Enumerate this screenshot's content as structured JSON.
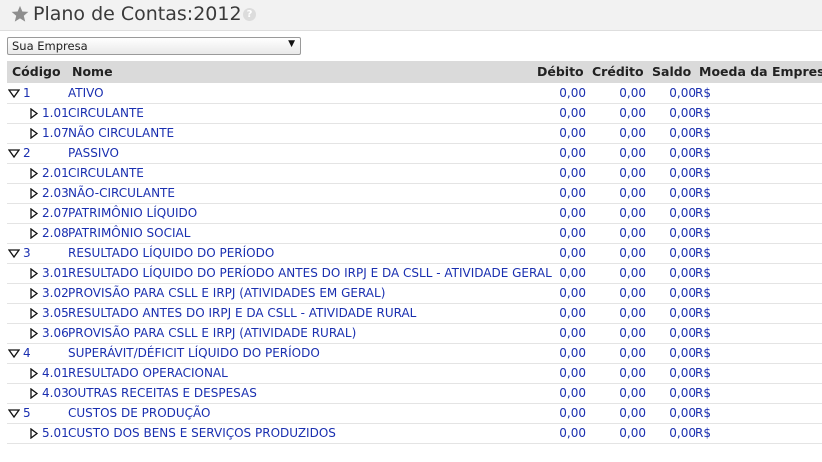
{
  "header": {
    "title": "Plano de Contas:2012",
    "help_icon": "?"
  },
  "company_select": {
    "value": "Sua Empresa",
    "arrow": "▼"
  },
  "columns": {
    "codigo": "Código",
    "nome": "Nome",
    "debito": "Débito",
    "credito": "Crédito",
    "saldo": "Saldo",
    "moeda": "Moeda da Empresa"
  },
  "colors": {
    "link": "#1a2fb0",
    "header_bg": "#dadada"
  },
  "rows": [
    {
      "level": 0,
      "expanded": true,
      "code": "1",
      "name": "ATIVO",
      "debito": "0,00",
      "credito": "0,00",
      "saldo": "0,00",
      "moeda": "R$"
    },
    {
      "level": 1,
      "expanded": false,
      "code": "1.01",
      "name": "CIRCULANTE",
      "debito": "0,00",
      "credito": "0,00",
      "saldo": "0,00",
      "moeda": "R$"
    },
    {
      "level": 1,
      "expanded": false,
      "code": "1.07",
      "name": "NÃO CIRCULANTE",
      "debito": "0,00",
      "credito": "0,00",
      "saldo": "0,00",
      "moeda": "R$"
    },
    {
      "level": 0,
      "expanded": true,
      "code": "2",
      "name": "PASSIVO",
      "debito": "0,00",
      "credito": "0,00",
      "saldo": "0,00",
      "moeda": "R$"
    },
    {
      "level": 1,
      "expanded": false,
      "code": "2.01",
      "name": "CIRCULANTE",
      "debito": "0,00",
      "credito": "0,00",
      "saldo": "0,00",
      "moeda": "R$"
    },
    {
      "level": 1,
      "expanded": false,
      "code": "2.03",
      "name": "NÃO-CIRCULANTE",
      "debito": "0,00",
      "credito": "0,00",
      "saldo": "0,00",
      "moeda": "R$"
    },
    {
      "level": 1,
      "expanded": false,
      "code": "2.07",
      "name": "PATRIMÔNIO LÍQUIDO",
      "debito": "0,00",
      "credito": "0,00",
      "saldo": "0,00",
      "moeda": "R$"
    },
    {
      "level": 1,
      "expanded": false,
      "code": "2.08",
      "name": "PATRIMÔNIO SOCIAL",
      "debito": "0,00",
      "credito": "0,00",
      "saldo": "0,00",
      "moeda": "R$"
    },
    {
      "level": 0,
      "expanded": true,
      "code": "3",
      "name": "RESULTADO LÍQUIDO DO PERÍODO",
      "debito": "0,00",
      "credito": "0,00",
      "saldo": "0,00",
      "moeda": "R$"
    },
    {
      "level": 1,
      "expanded": false,
      "code": "3.01",
      "name": "RESULTADO LÍQUIDO DO PERÍODO ANTES DO IRPJ E DA CSLL - ATIVIDADE GERAL",
      "debito": "0,00",
      "credito": "0,00",
      "saldo": "0,00",
      "moeda": "R$"
    },
    {
      "level": 1,
      "expanded": false,
      "code": "3.02",
      "name": "PROVISÃO PARA CSLL E IRPJ (ATIVIDADES EM GERAL)",
      "debito": "0,00",
      "credito": "0,00",
      "saldo": "0,00",
      "moeda": "R$"
    },
    {
      "level": 1,
      "expanded": false,
      "code": "3.05",
      "name": "RESULTADO ANTES DO IRPJ E DA CSLL - ATIVIDADE RURAL",
      "debito": "0,00",
      "credito": "0,00",
      "saldo": "0,00",
      "moeda": "R$"
    },
    {
      "level": 1,
      "expanded": false,
      "code": "3.06",
      "name": "PROVISÃO PARA CSLL E IRPJ (ATIVIDADE RURAL)",
      "debito": "0,00",
      "credito": "0,00",
      "saldo": "0,00",
      "moeda": "R$"
    },
    {
      "level": 0,
      "expanded": true,
      "code": "4",
      "name": "SUPERÁVIT/DÉFICIT LÍQUIDO DO PERÍODO",
      "debito": "0,00",
      "credito": "0,00",
      "saldo": "0,00",
      "moeda": "R$"
    },
    {
      "level": 1,
      "expanded": false,
      "code": "4.01",
      "name": "RESULTADO OPERACIONAL",
      "debito": "0,00",
      "credito": "0,00",
      "saldo": "0,00",
      "moeda": "R$"
    },
    {
      "level": 1,
      "expanded": false,
      "code": "4.03",
      "name": "OUTRAS RECEITAS E DESPESAS",
      "debito": "0,00",
      "credito": "0,00",
      "saldo": "0,00",
      "moeda": "R$"
    },
    {
      "level": 0,
      "expanded": true,
      "code": "5",
      "name": "CUSTOS DE PRODUÇÃO",
      "debito": "0,00",
      "credito": "0,00",
      "saldo": "0,00",
      "moeda": "R$"
    },
    {
      "level": 1,
      "expanded": false,
      "code": "5.01",
      "name": "CUSTO DOS BENS E SERVIÇOS PRODUZIDOS",
      "debito": "0,00",
      "credito": "0,00",
      "saldo": "0,00",
      "moeda": "R$"
    }
  ]
}
